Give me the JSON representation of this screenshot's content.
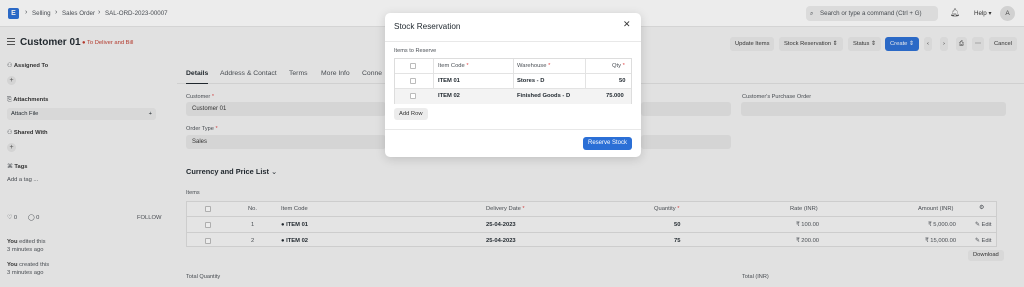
{
  "nav": {
    "logo_letter": "E",
    "breadcrumbs": [
      "Selling",
      "Sales Order",
      "SAL-ORD-2023-00007"
    ],
    "search_placeholder": "Search or type a command (Ctrl + G)",
    "help_label": "Help",
    "avatar_letter": "A"
  },
  "header": {
    "title": "Customer 01",
    "status": "To Deliver and Bill",
    "buttons": {
      "update_items": "Update Items",
      "stock_reservation": "Stock Reservation",
      "status": "Status",
      "create": "Create",
      "cancel": "Cancel"
    }
  },
  "sidebar": {
    "assigned_to": "Assigned To",
    "attachments": "Attachments",
    "attach_file": "Attach File",
    "shared_with": "Shared With",
    "tags": "Tags",
    "add_tag": "Add a tag ...",
    "likes": "0",
    "comments": "0",
    "follow": "FOLLOW",
    "activity": [
      {
        "who": "You",
        "what": " edited this",
        "when": "3 minutes ago"
      },
      {
        "who": "You",
        "what": " created this",
        "when": "3 minutes ago"
      }
    ]
  },
  "tabs": [
    "Details",
    "Address & Contact",
    "Terms",
    "More Info",
    "Conne"
  ],
  "form": {
    "customer_label": "Customer",
    "customer_value": "Customer 01",
    "order_type_label": "Order Type",
    "order_type_value": "Sales",
    "customer_po_label": "Customer's Purchase Order",
    "section_title": "Currency and Price List",
    "items_label": "Items",
    "total_qty_label": "Total Quantity",
    "total_inr_label": "Total (INR)",
    "download": "Download"
  },
  "items_table": {
    "headers": {
      "no": "No.",
      "item_code": "Item Code",
      "delivery_date": "Delivery Date",
      "quantity": "Quantity",
      "rate": "Rate (INR)",
      "amount": "Amount (INR)"
    },
    "rows": [
      {
        "no": "1",
        "item_code": "ITEM 01",
        "delivery_date": "25-04-2023",
        "quantity": "50",
        "rate": "₹ 100.00",
        "amount": "₹ 5,000.00",
        "edit": "Edit"
      },
      {
        "no": "2",
        "item_code": "ITEM 02",
        "delivery_date": "25-04-2023",
        "quantity": "75",
        "rate": "₹ 200.00",
        "amount": "₹ 15,000.00",
        "edit": "Edit"
      }
    ]
  },
  "modal": {
    "title": "Stock Reservation",
    "section_label": "Items to Reserve",
    "headers": {
      "item_code": "Item Code",
      "warehouse": "Warehouse",
      "qty": "Qty"
    },
    "rows": [
      {
        "item_code": "ITEM 01",
        "warehouse": "Stores - D",
        "qty": "50"
      },
      {
        "item_code": "ITEM 02",
        "warehouse": "Finished Goods - D",
        "qty": "75.000"
      }
    ],
    "add_row": "Add Row",
    "reserve_button": "Reserve Stock"
  },
  "colors": {
    "primary": "#2b6fd6",
    "status_red": "#c0392b"
  }
}
